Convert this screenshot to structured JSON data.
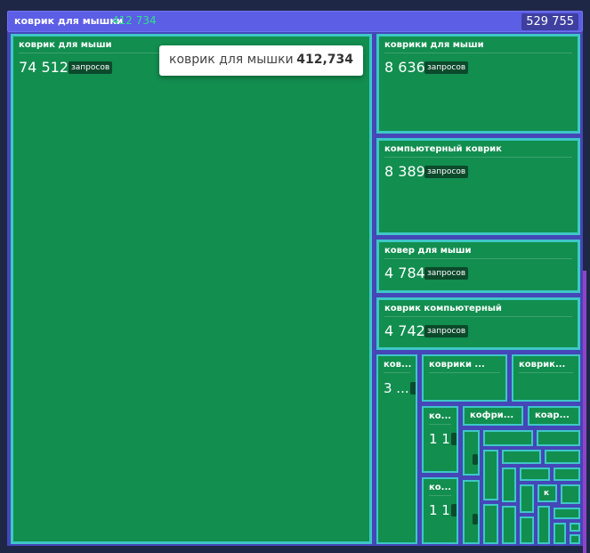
{
  "header": {
    "title": "коврик для мышки",
    "subtitle": "412 734",
    "total": "529 755"
  },
  "tooltip": {
    "label": "коврик для мышки",
    "value": "412,734"
  },
  "tiles": {
    "main": {
      "label": "коврик для мыши",
      "value": "74 512",
      "unit": "запросов"
    },
    "t2": {
      "label": "коврики для мыши",
      "value": "8 636",
      "unit": "запросов"
    },
    "t3": {
      "label": "компьютерный коврик",
      "value": "8 389",
      "unit": "запросов"
    },
    "t4": {
      "label": "ковер для мыши",
      "value": "4 784",
      "unit": "запросов"
    },
    "t5": {
      "label": "коврик компьютерный",
      "value": "4 742",
      "unit": "запросов"
    },
    "t6": {
      "label": "ков...",
      "value": "3 ..."
    },
    "t7": {
      "label": "коврики ..."
    },
    "t8": {
      "label": "коврик..."
    },
    "t9": {
      "label": "ко...",
      "value": "1 1"
    },
    "t10": {
      "label": "кофри..."
    },
    "t11": {
      "label": "коар..."
    },
    "t12": {
      "label": "ко...",
      "value": "1 1"
    },
    "t13": {
      "label": "к"
    }
  }
}
